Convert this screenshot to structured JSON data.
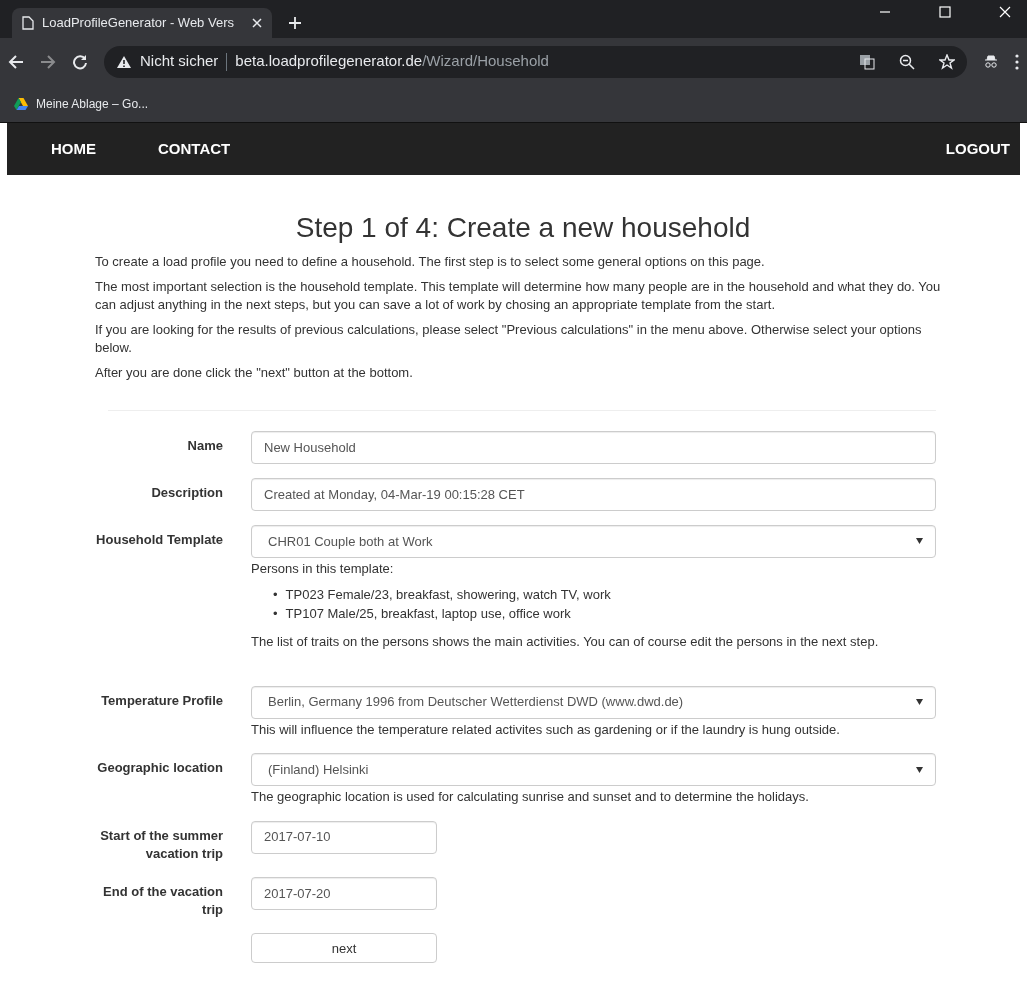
{
  "browser": {
    "tab_title": "LoadProfileGenerator - Web Vers",
    "security": "Nicht sicher",
    "url_host": "beta.loadprofilegenerator.de",
    "url_path": "/Wizard/Household",
    "bookmark": "Meine Ablage – Go..."
  },
  "nav": {
    "left": [
      "HOME",
      "CONTACT"
    ],
    "right": [
      "LOGOUT"
    ]
  },
  "title": "Step 1 of 4: Create a new household",
  "intro": [
    "To create a load profile you need to define a household. The first step is to select some general options on this page.",
    "The most important selection is the household template. This template will determine how many people are in the household and what they do. You can adjust anything in the next steps, but you can save a lot of work by chosing an appropriate template from the start.",
    "If you are looking for the results of previous calculations, please select \"Previous calculations\" in the menu above. Otherwise select your options below.",
    "After you are done click the \"next\" button at the bottom."
  ],
  "fields": [
    {
      "label": "Name",
      "kind": "text",
      "value": "New Household"
    },
    {
      "label": "Description",
      "kind": "text",
      "value": "Created at Monday, 04-Mar-19 00:15:28 CET"
    },
    {
      "label": "Household Template",
      "kind": "select",
      "value": "CHR01 Couple both at Work",
      "help": "Persons in this template:",
      "persons": [
        {
          "marker": "•",
          "text": "TP023 Female/23, breakfast, showering, watch TV, work"
        },
        {
          "marker": "•",
          "text": "TP107 Male/25, breakfast, laptop use, office work"
        }
      ],
      "note": "The list of traits on the persons shows the main activities. You can of course edit the persons in the next step."
    },
    {
      "label": "Temperature Profile",
      "kind": "select",
      "value": "Berlin, Germany 1996 from Deutscher Wetterdienst DWD (www.dwd.de)",
      "help": "This will influence the temperature related activites such as gardening or if the laundry is hung outside."
    },
    {
      "label": "Geographic location",
      "kind": "select",
      "value": "(Finland) Helsinki",
      "help": "The geographic location is used for calculating sunrise and sunset and to determine the holidays."
    },
    {
      "label": "Start of the summer vacation trip",
      "kind": "date",
      "value": "2017-07-10"
    },
    {
      "label": "End of the vacation trip",
      "kind": "date",
      "value": "2017-07-20"
    }
  ],
  "submit": "next"
}
